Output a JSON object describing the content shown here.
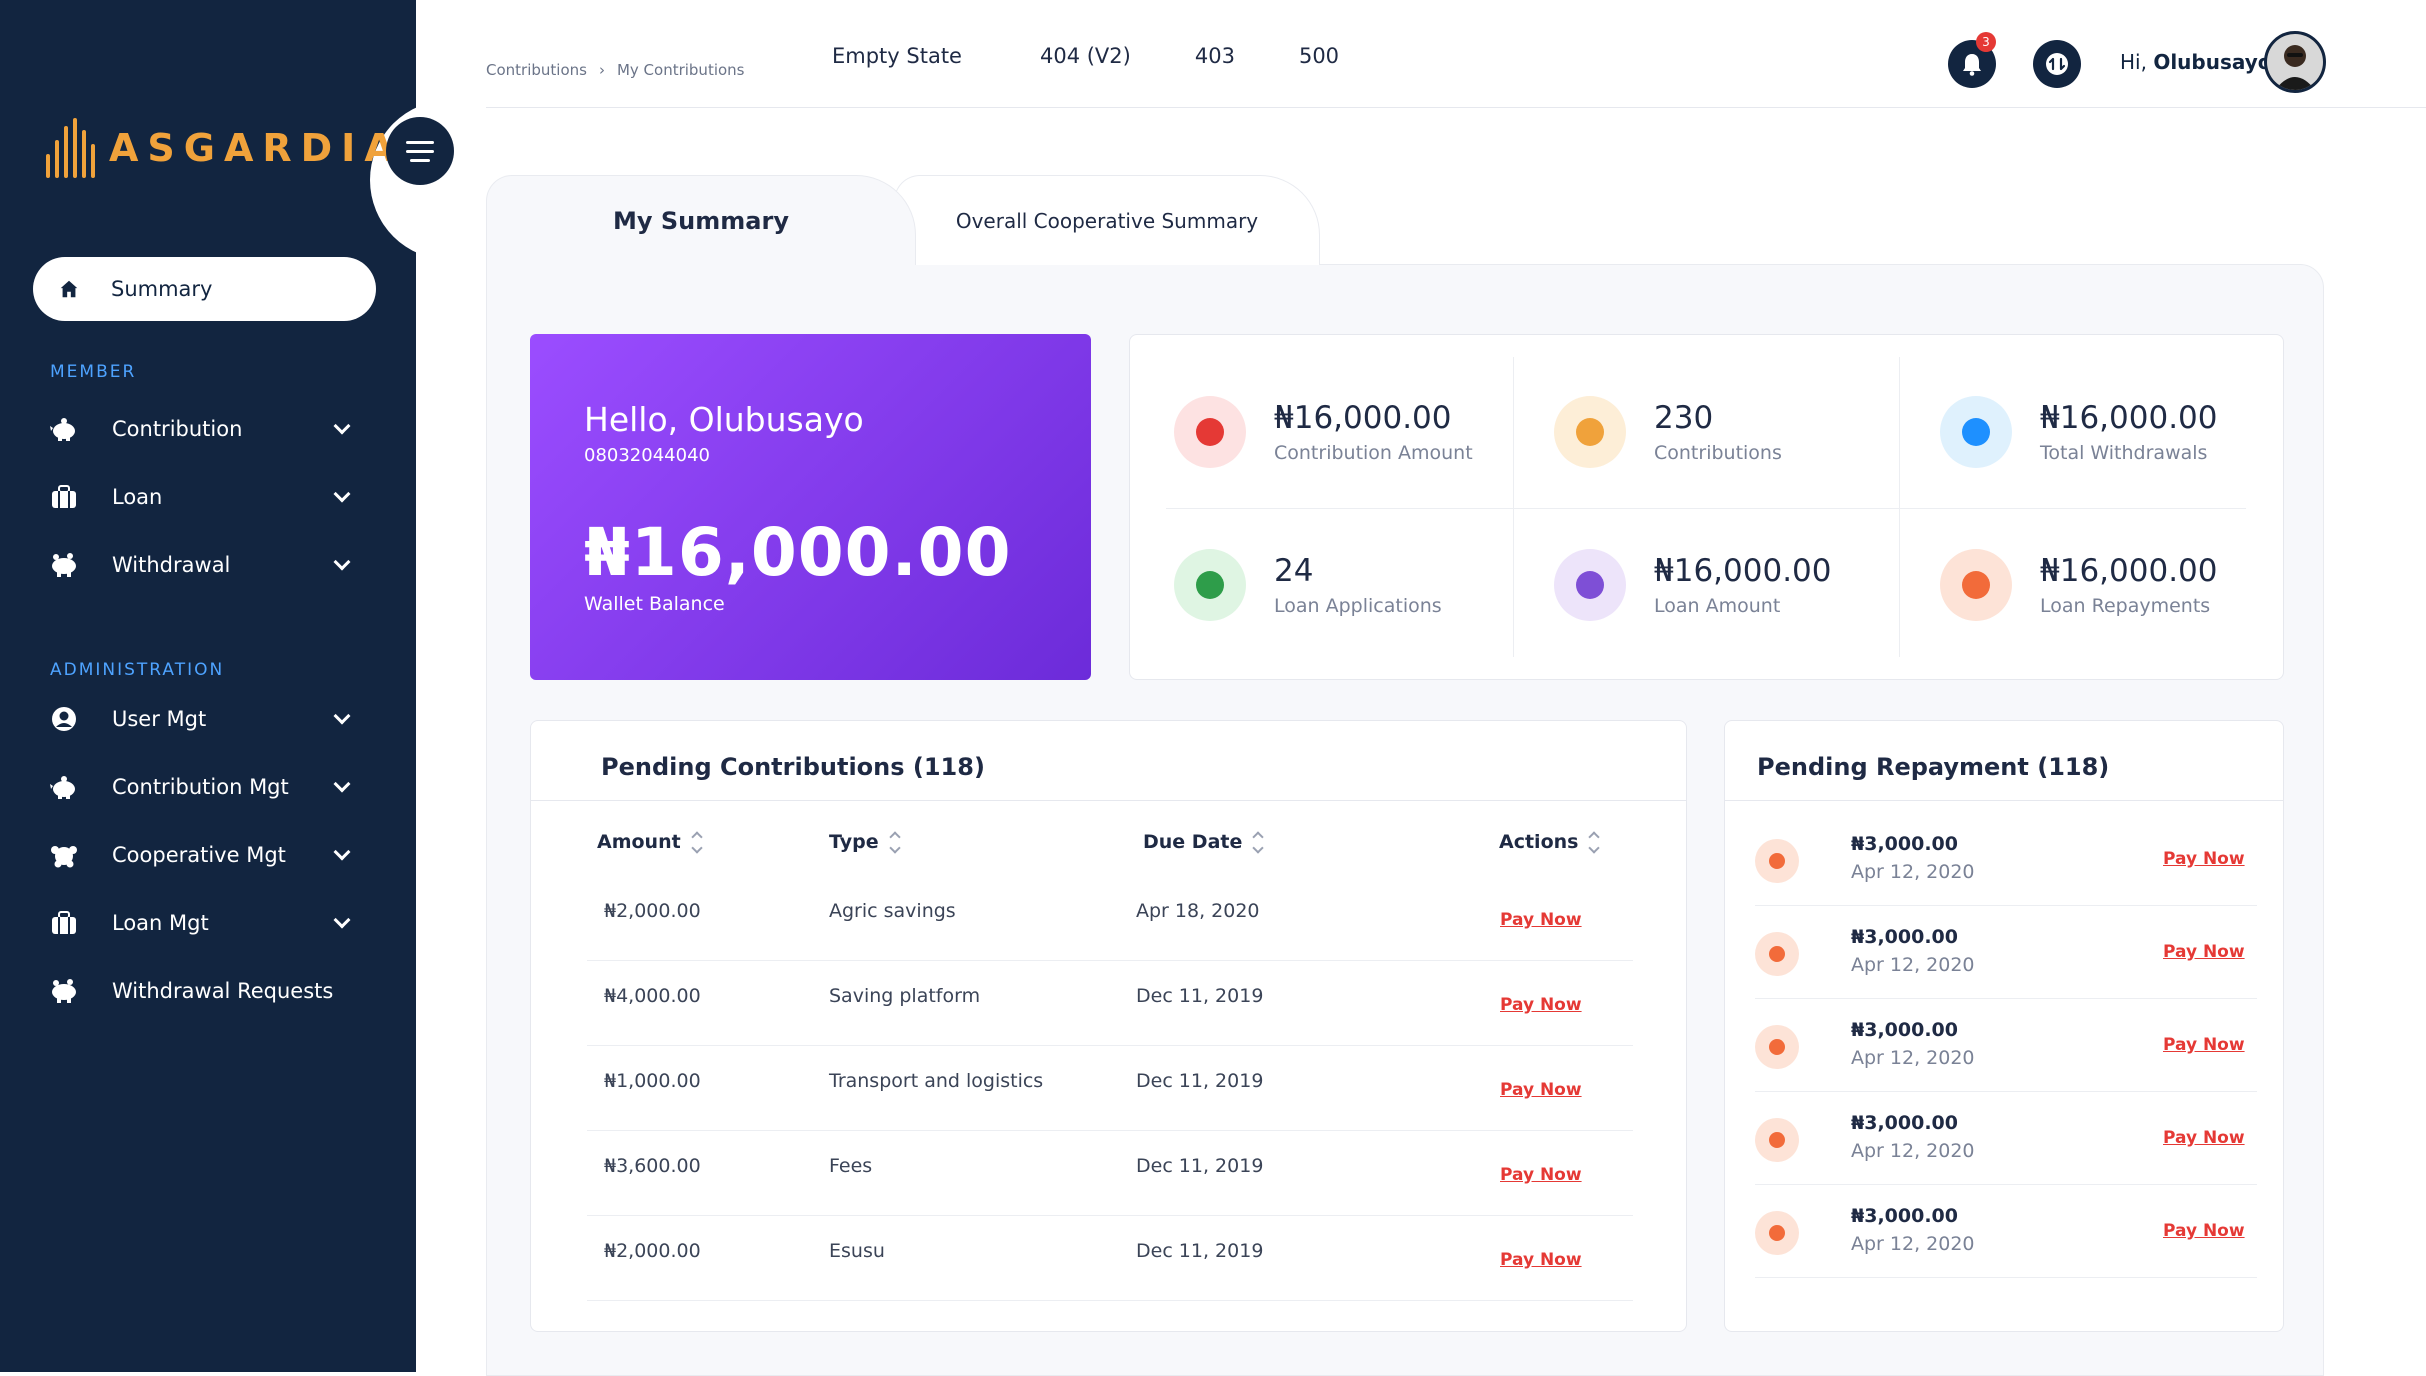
{
  "brand": {
    "name": "ASGARDIA",
    "accent": "#f0a23b"
  },
  "sidebar": {
    "active": {
      "label": "Summary",
      "icon": "home-icon"
    },
    "member_title": "MEMBER",
    "member_items": [
      {
        "label": "Contribution",
        "icon": "piggy-bank-icon"
      },
      {
        "label": "Loan",
        "icon": "briefcase-icon"
      },
      {
        "label": "Withdrawal",
        "icon": "piggy-bank-icon"
      }
    ],
    "admin_title": "ADMINISTRATION",
    "admin_items": [
      {
        "label": "User Mgt",
        "icon": "user-icon"
      },
      {
        "label": "Contribution Mgt",
        "icon": "piggy-bank-icon"
      },
      {
        "label": "Cooperative Mgt",
        "icon": "group-icon"
      },
      {
        "label": "Loan Mgt",
        "icon": "briefcase-icon"
      },
      {
        "label": "Withdrawal Requests",
        "icon": "piggy-bank-icon"
      }
    ]
  },
  "topbar": {
    "breadcrumb": [
      "Contributions",
      "My Contributions"
    ],
    "links": [
      "Empty State",
      "404 (V2)",
      "403",
      "500"
    ],
    "notification_count": "3",
    "greeting_prefix": "Hi,",
    "user_name": "Olubusayo"
  },
  "tabs": {
    "my_summary": "My Summary",
    "overall": "Overall Cooperative Summary"
  },
  "wallet": {
    "hello": "Hello, Olubusayo",
    "phone": "08032044040",
    "balance": "₦16,000.00",
    "balance_label": "Wallet Balance"
  },
  "stats": [
    {
      "value": "₦16,000.00",
      "label": "Contribution Amount",
      "color": "#e53935",
      "bg": "#fde2e2"
    },
    {
      "value": "230",
      "label": "Contributions",
      "color": "#f0a23b",
      "bg": "#fdeed7"
    },
    {
      "value": "₦16,000.00",
      "label": "Total Withdrawals",
      "color": "#1e90ff",
      "bg": "#dff1fd"
    },
    {
      "value": "24",
      "label": "Loan Applications",
      "color": "#2e9d4a",
      "bg": "#dff5e3"
    },
    {
      "value": "₦16,000.00",
      "label": "Loan Amount",
      "color": "#7e4fd6",
      "bg": "#ede4fa"
    },
    {
      "value": "₦16,000.00",
      "label": "Loan Repayments",
      "color": "#f26b3a",
      "bg": "#fde3d7"
    }
  ],
  "pending_contributions": {
    "title": "Pending Contributions (118)",
    "headers": [
      "Amount",
      "Type",
      "Due Date",
      "Actions"
    ],
    "rows": [
      {
        "amount": "₦2,000.00",
        "type": "Agric savings",
        "due": "Apr 18, 2020",
        "action": "Pay Now"
      },
      {
        "amount": "₦4,000.00",
        "type": "Saving platform",
        "due": "Dec 11, 2019",
        "action": "Pay Now"
      },
      {
        "amount": "₦1,000.00",
        "type": "Transport and logistics",
        "due": "Dec 11, 2019",
        "action": "Pay Now"
      },
      {
        "amount": "₦3,600.00",
        "type": "Fees",
        "due": "Dec 11, 2019",
        "action": "Pay Now"
      },
      {
        "amount": "₦2,000.00",
        "type": "Esusu",
        "due": "Dec 11, 2019",
        "action": "Pay Now"
      }
    ]
  },
  "pending_repayment": {
    "title": "Pending Repayment (118)",
    "rows": [
      {
        "amount": "₦3,000.00",
        "date": "Apr 12, 2020",
        "action": "Pay Now"
      },
      {
        "amount": "₦3,000.00",
        "date": "Apr 12, 2020",
        "action": "Pay Now"
      },
      {
        "amount": "₦3,000.00",
        "date": "Apr 12, 2020",
        "action": "Pay Now"
      },
      {
        "amount": "₦3,000.00",
        "date": "Apr 12, 2020",
        "action": "Pay Now"
      },
      {
        "amount": "₦3,000.00",
        "date": "Apr 12, 2020",
        "action": "Pay Now"
      }
    ]
  }
}
